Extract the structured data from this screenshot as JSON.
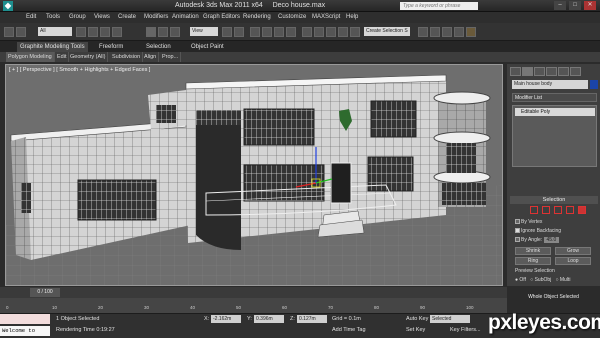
{
  "title": {
    "app_name": "Autodesk 3ds Max  2011 x64",
    "file_name": "Deco house.max",
    "search_placeholder": "Type a keyword or phrase"
  },
  "menu": [
    "Edit",
    "Tools",
    "Group",
    "Views",
    "Create",
    "Modifiers",
    "Animation",
    "Graph Editors",
    "Rendering",
    "Customize",
    "MAXScript",
    "Help"
  ],
  "toolbar": {
    "filter_value": "All",
    "view_value": "View",
    "selection_set_value": "Create Selection S"
  },
  "ribbon": {
    "tabs": [
      "Graphite Modeling Tools",
      "Freeform",
      "Selection",
      "Object Paint"
    ],
    "subtabs": [
      "Polygon Modeling",
      "Edit",
      "Geometry (All)",
      "Subdivision",
      "Align",
      "Prop..."
    ]
  },
  "viewport": {
    "label": "[ + ] [ Perspective ] [ Smooth + Highlights + Edged Faces ]"
  },
  "command_panel": {
    "object_name": "Main house body",
    "modifier_list_label": "Modifier List",
    "stack_item": "Editable Poly",
    "rollout_title": "Selection",
    "by_vertex": "By Vertex",
    "ignore_backfacing": "Ignore Backfacing",
    "by_angle": "By Angle:",
    "by_angle_value": "45.0",
    "shrink": "Shrink",
    "grow": "Grow",
    "ring": "Ring",
    "loop": "Loop",
    "preview_title": "Preview Selection",
    "preview_off": "Off",
    "preview_subobj": "SubObj",
    "preview_multi": "Multi",
    "selection_status": "Whole Object Selected"
  },
  "timeline": {
    "frame_indicator": "0 / 100",
    "ticks": [
      "0",
      "10",
      "20",
      "30",
      "40",
      "50",
      "60",
      "70",
      "80",
      "90",
      "100"
    ]
  },
  "status": {
    "selected": "1 Object Selected",
    "rendering_time": "Rendering Time  0:19:27",
    "x_label": "X:",
    "x_value": "-2.162m",
    "y_label": "Y:",
    "y_value": "0.396m",
    "z_label": "Z:",
    "z_value": "0.127m",
    "grid": "Grid = 0.1m",
    "add_time_tag": "Add Time Tag",
    "auto_key": "Auto Key",
    "auto_key_mode": "Selected",
    "set_key": "Set Key",
    "key_filters": "Key Filters...",
    "welcome": "Welcome to M..."
  },
  "watermark": "pxleyes.com",
  "colors": {
    "accent": "#1e8f8f",
    "gizmo_x": "#e02020",
    "gizmo_y": "#20c020",
    "gizmo_z": "#2040e0"
  }
}
